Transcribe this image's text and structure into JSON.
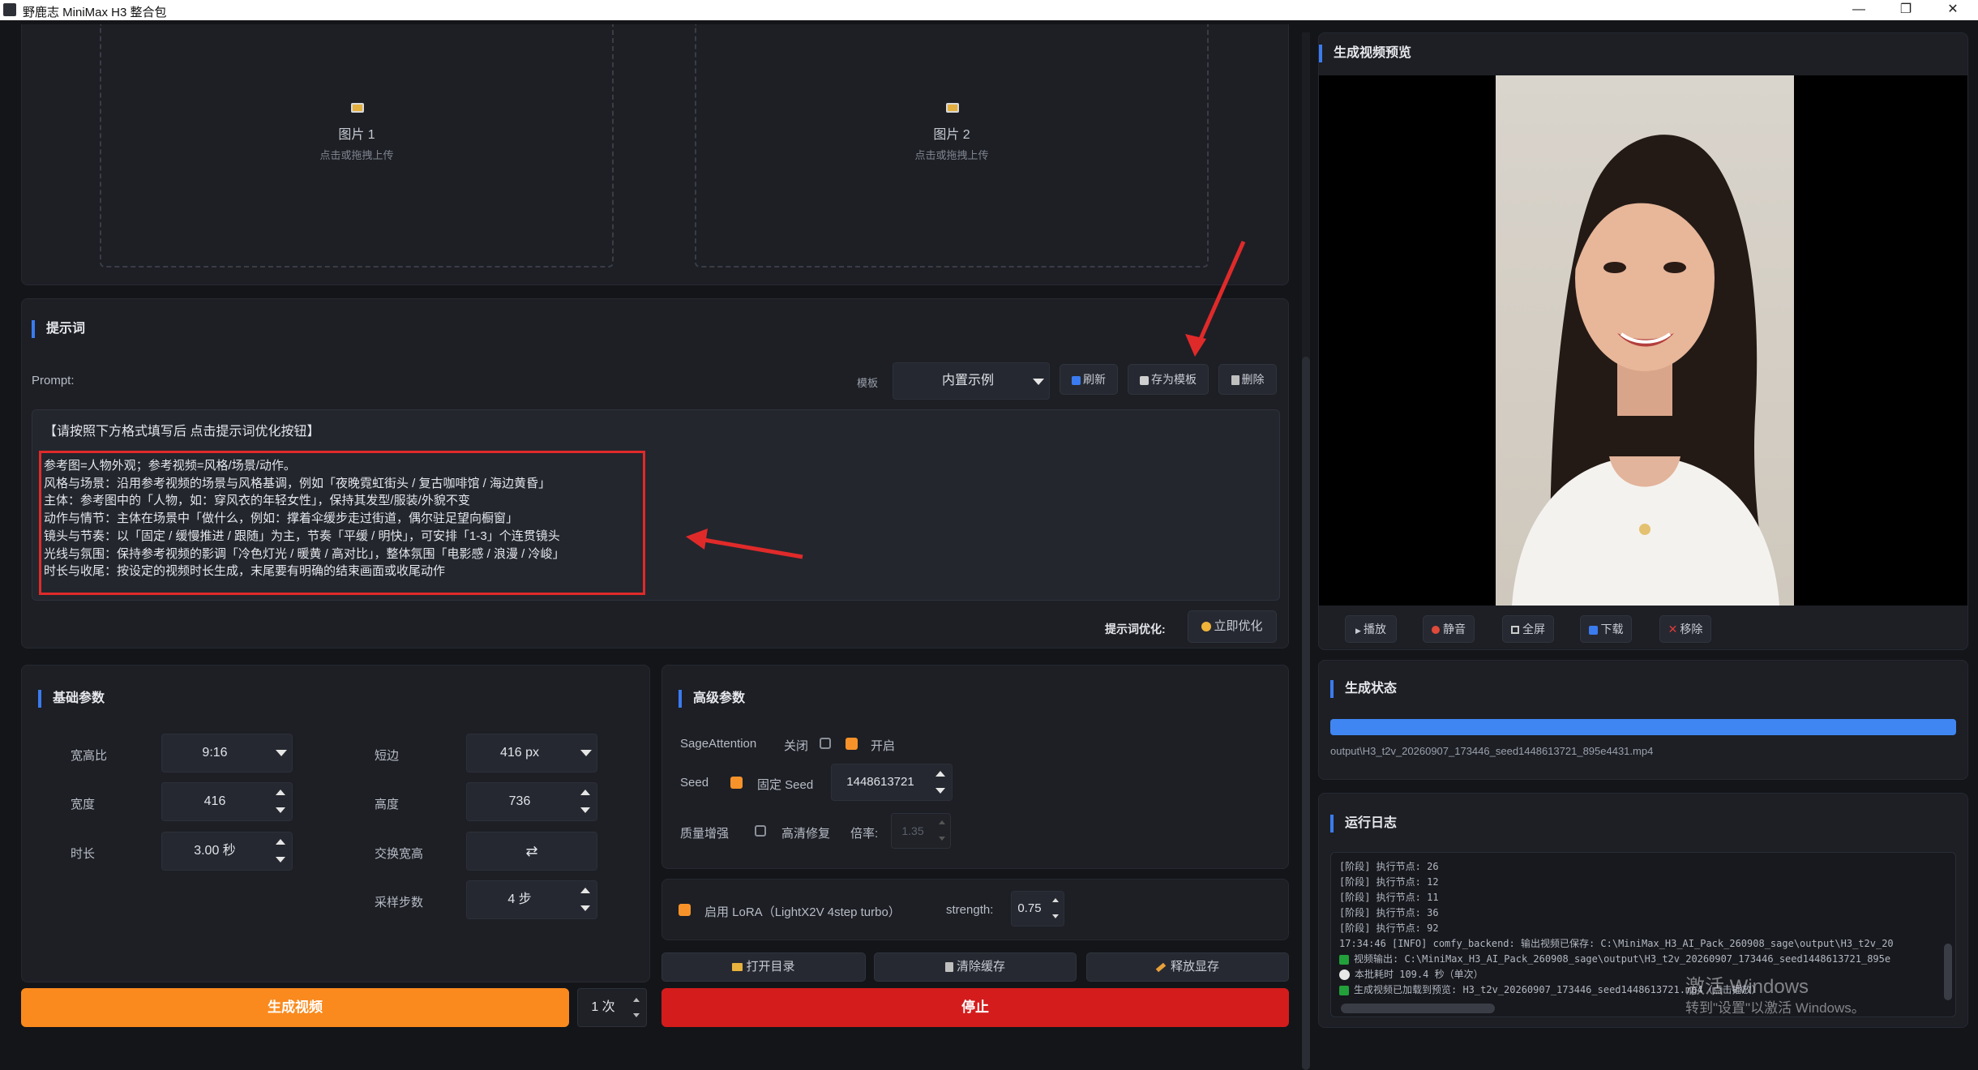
{
  "window": {
    "title": "野鹿志 MiniMax H3 整合包",
    "minimize": "—",
    "restore": "❐",
    "close": "✕"
  },
  "upload": {
    "slot1_label": "图片 1",
    "slot1_hint": "点击或拖拽上传",
    "slot2_label": "图片 2",
    "slot2_hint": "点击或拖拽上传"
  },
  "prompt": {
    "section_title": "提示词",
    "prompt_label": "Prompt:",
    "template_label": "模板",
    "template_selected": "内置示例",
    "refresh_label": "刷新",
    "save_template_label": "存为模板",
    "delete_label": "删除",
    "header_line": "【请按照下方格式填写后 点击提示词优化按钮】",
    "lines": [
      "参考图=人物外观；参考视频=风格/场景/动作。",
      "风格与场景：沿用参考视频的场景与风格基调，例如「夜晚霓虹街头 / 复古咖啡馆 / 海边黄昏」",
      "主体：参考图中的「人物，如：穿风衣的年轻女性」，保持其发型/服装/外貌不变",
      "动作与情节：主体在场景中「做什么，例如：撑着伞缓步走过街道，偶尔驻足望向橱窗」",
      "镜头与节奏：以「固定 / 缓慢推进 / 跟随」为主，节奏「平缓 / 明快」，可安排「1-3」个连贯镜头",
      "光线与氛围：保持参考视频的影调「冷色灯光 / 暖黄 / 高对比」，整体氛围「电影感 / 浪漫 / 冷峻」",
      "时长与收尾：按设定的视频时长生成，末尾要有明确的结束画面或收尾动作"
    ],
    "optimize_label": "提示词优化:",
    "optimize_button": "立即优化"
  },
  "basic": {
    "section_title": "基础参数",
    "aspect_label": "宽高比",
    "aspect_value": "9:16",
    "short_label": "短边",
    "short_value": "416 px",
    "width_label": "宽度",
    "width_value": "416",
    "height_label": "高度",
    "height_value": "736",
    "duration_label": "时长",
    "duration_value": "3.00 秒",
    "swap_label": "交换宽高",
    "swap_button": "⇄",
    "steps_label": "采样步数",
    "steps_value": "4 步"
  },
  "advanced": {
    "section_title": "高级参数",
    "sage_label": "SageAttention",
    "sage_off": "关闭",
    "sage_on": "开启",
    "seed_label": "Seed",
    "seed_fixed": "固定 Seed",
    "seed_value": "1448613721",
    "quality_label": "质量增强",
    "hires_label": "高清修复",
    "ratio_label": "倍率:",
    "ratio_value": "1.35"
  },
  "lora": {
    "enable_label": "启用 LoRA（LightX2V 4step turbo）",
    "strength_label": "strength:",
    "strength_value": "0.75"
  },
  "actions": {
    "open_dir": "打开目录",
    "clear_cache": "清除缓存",
    "free_vram": "释放显存",
    "generate": "生成视频",
    "count": "1 次",
    "stop": "停止"
  },
  "preview": {
    "section_title": "生成视频预览",
    "play": "播放",
    "mute": "静音",
    "fullscreen": "全屏",
    "download": "下载",
    "remove": "移除"
  },
  "status": {
    "section_title": "生成状态",
    "progress": 1.0,
    "output_path": "output\\H3_t2v_20260907_173446_seed1448613721_895e4431.mp4"
  },
  "log": {
    "section_title": "运行日志",
    "lines": [
      "[阶段] 执行节点: 26",
      "[阶段] 执行节点: 12",
      "[阶段] 执行节点: 11",
      "[阶段] 执行节点: 36",
      "[阶段] 执行节点: 92",
      "17:34:46 [INFO] comfy_backend: 输出视频已保存: C:\\MiniMax_H3_AI_Pack_260908_sage\\output\\H3_t2v_20",
      "视频输出: C:\\MiniMax_H3_AI_Pack_260908_sage\\output\\H3_t2v_20260907_173446_seed1448613721_895e",
      "本批耗时 109.4 秒（单次）",
      "生成视频已加载到预览: H3_t2v_20260907_173446_seed1448613721.mp4（点击播放）"
    ],
    "watermark_line1": "激活 Windows",
    "watermark_line2": "转到\"设置\"以激活 Windows。"
  },
  "colors": {
    "accent": "#3a7bef",
    "generate": "#fa8a1e",
    "stop": "#d41c1c",
    "annotation": "#e02a2a",
    "progress": "#3f86f2"
  }
}
